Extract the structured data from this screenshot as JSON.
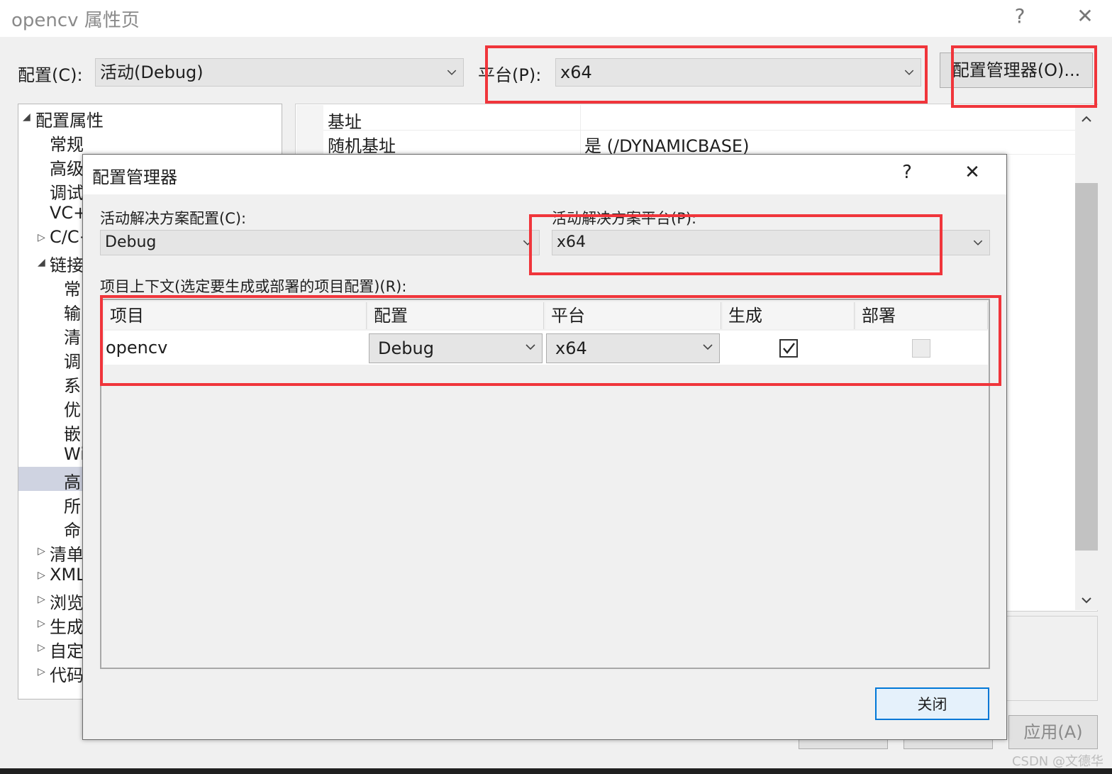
{
  "window": {
    "title": "opencv 属性页",
    "help_icon": "?",
    "close_icon": "✕"
  },
  "toolbar": {
    "config_label": "配置(C):",
    "config_value": "活动(Debug)",
    "platform_label": "平台(P):",
    "platform_value": "x64",
    "config_manager_button": "配置管理器(O)..."
  },
  "tree": {
    "root": "配置属性",
    "items": [
      "常规",
      "高级",
      "调试",
      "VC+",
      "C/C+",
      "链接",
      "常",
      "输",
      "清",
      "调",
      "系",
      "优",
      "嵌",
      "Wi",
      "高",
      "所",
      "命",
      "清单",
      "XML",
      "浏览",
      "生成",
      "自定",
      "代码"
    ]
  },
  "properties": [
    {
      "name": "基址",
      "value": ""
    },
    {
      "name": "随机基址",
      "value": "是 (/DYNAMICBASE)"
    }
  ],
  "bottom_buttons": {
    "apply": "应用(A)"
  },
  "dialog": {
    "title": "配置管理器",
    "help_icon": "?",
    "close_icon": "✕",
    "active_config_label": "活动解决方案配置(C):",
    "active_config_value": "Debug",
    "active_platform_label": "活动解决方案平台(P):",
    "active_platform_value": "x64",
    "project_context_label": "项目上下文(选定要生成或部署的项目配置)(R):",
    "columns": [
      "项目",
      "配置",
      "平台",
      "生成",
      "部署"
    ],
    "rows": [
      {
        "project": "opencv",
        "config": "Debug",
        "platform": "x64",
        "build": true,
        "deploy": false
      }
    ],
    "close_button": "关闭"
  },
  "watermark": "CSDN @文德华",
  "colors": {
    "highlight": "#f0353b",
    "selection": "#cfd3e1"
  }
}
